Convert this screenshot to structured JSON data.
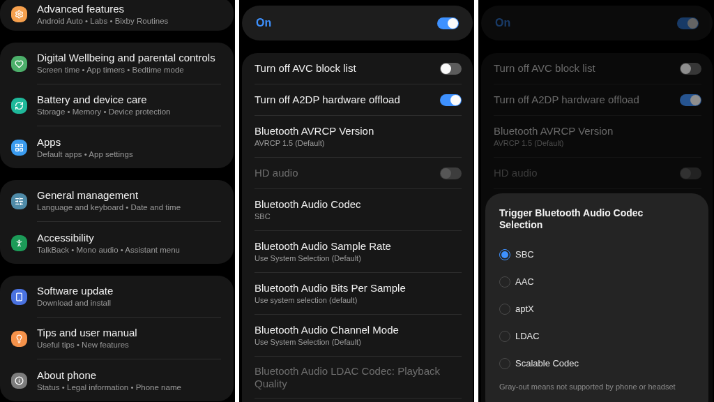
{
  "settings_menu": {
    "groups": [
      {
        "items": [
          {
            "title": "Advanced features",
            "subtitle": "Android Auto  •  Labs  •  Bixby Routines",
            "color": "#f6a04d"
          }
        ]
      },
      {
        "items": [
          {
            "title": "Digital Wellbeing and parental controls",
            "subtitle": "Screen time  •  App timers  •  Bedtime mode",
            "color": "#4caf6a"
          },
          {
            "title": "Battery and device care",
            "subtitle": "Storage  •  Memory  •  Device protection",
            "color": "#1fb89a"
          },
          {
            "title": "Apps",
            "subtitle": "Default apps  •  App settings",
            "color": "#3a9bef"
          }
        ]
      },
      {
        "items": [
          {
            "title": "General management",
            "subtitle": "Language and keyboard  •  Date and time",
            "color": "#4f8ba8"
          },
          {
            "title": "Accessibility",
            "subtitle": "TalkBack  •  Mono audio  •  Assistant menu",
            "color": "#1c9b58"
          }
        ]
      },
      {
        "items": [
          {
            "title": "Software update",
            "subtitle": "Download and install",
            "color": "#4a72e0"
          },
          {
            "title": "Tips and user manual",
            "subtitle": "Useful tips  •  New features",
            "color": "#f5924a"
          },
          {
            "title": "About phone",
            "subtitle": "Status  •  Legal information  •  Phone name",
            "color": "#7d7d7d"
          }
        ]
      }
    ]
  },
  "developer_options": {
    "master": {
      "label": "On",
      "on": true
    },
    "rows": [
      {
        "kind": "toggle",
        "title": "Turn off AVC block list",
        "on": false,
        "disabled": false
      },
      {
        "kind": "toggle",
        "title": "Turn off A2DP hardware offload",
        "on": true,
        "disabled": false
      },
      {
        "kind": "value",
        "title": "Bluetooth AVRCP Version",
        "subtitle": "AVRCP 1.5 (Default)",
        "disabled": false
      },
      {
        "kind": "toggle",
        "title": "HD audio",
        "on": false,
        "disabled": true
      },
      {
        "kind": "value",
        "title": "Bluetooth Audio Codec",
        "subtitle": "SBC",
        "disabled": false
      },
      {
        "kind": "value",
        "title": "Bluetooth Audio Sample Rate",
        "subtitle": "Use System Selection (Default)",
        "disabled": false
      },
      {
        "kind": "value",
        "title": "Bluetooth Audio Bits Per Sample",
        "subtitle": "Use system selection (default)",
        "disabled": false
      },
      {
        "kind": "value",
        "title": "Bluetooth Audio Channel Mode",
        "subtitle": "Use System Selection (Default)",
        "disabled": false
      },
      {
        "kind": "value",
        "title": "Bluetooth Audio LDAC Codec: Playback Quality",
        "disabled": true
      }
    ]
  },
  "codec_dialog": {
    "background": {
      "master": {
        "label": "On",
        "on": true
      },
      "rows": [
        {
          "kind": "toggle",
          "title": "Turn off AVC block list",
          "on": false,
          "disabled": false
        },
        {
          "kind": "toggle",
          "title": "Turn off A2DP hardware offload",
          "on": true,
          "disabled": false
        },
        {
          "kind": "value",
          "title": "Bluetooth AVRCP Version",
          "subtitle": "AVRCP 1.5 (Default)",
          "disabled": false
        },
        {
          "kind": "toggle",
          "title": "HD audio",
          "on": false,
          "disabled": true
        }
      ]
    },
    "title": "Trigger Bluetooth Audio Codec Selection",
    "options": [
      {
        "label": "SBC",
        "selected": true
      },
      {
        "label": "AAC",
        "selected": false
      },
      {
        "label": "aptX",
        "selected": false
      },
      {
        "label": "LDAC",
        "selected": false
      },
      {
        "label": "Scalable Codec",
        "selected": false
      }
    ],
    "note": "Gray-out means not supported by phone or headset"
  }
}
